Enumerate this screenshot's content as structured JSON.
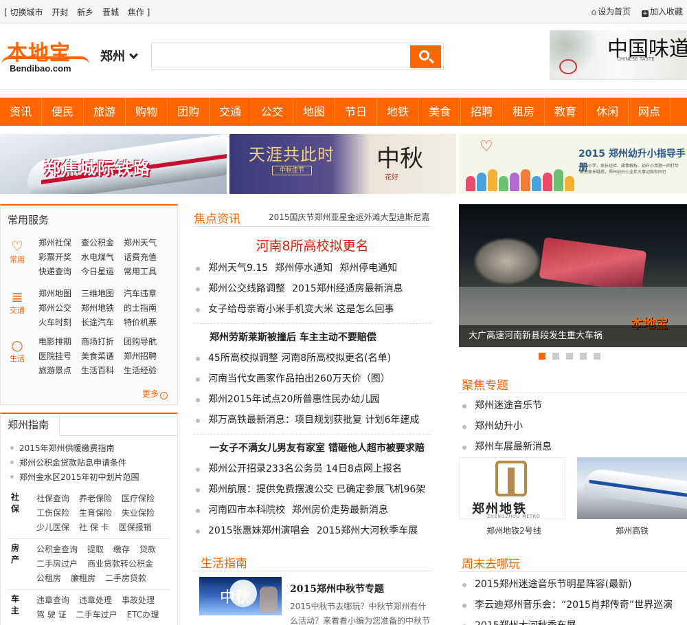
{
  "topbar": {
    "cities": [
      "[ 切换城市",
      "开封",
      "新乡",
      "晋城",
      "焦作 ]"
    ],
    "set_home": "设为首页",
    "add_fav": "加入收藏"
  },
  "header": {
    "logo_cn": "本地宝",
    "logo_en": "Bendibao.com",
    "city": "郑州",
    "search_placeholder": "",
    "banner_text": "中国味道",
    "banner_sub": "CHINESE TASTE"
  },
  "nav": [
    "资讯",
    "便民",
    "旅游",
    "购物",
    "团购",
    "交通",
    "公交",
    "地图",
    "节日",
    "地铁",
    "美食",
    "招聘",
    "租房",
    "教育",
    "休闲",
    "网点"
  ],
  "banners": {
    "b1": "郑焦城际铁路",
    "b2_title": "天涯共此时",
    "b2_tag": "中秋佳节",
    "b2_moon": "中秋",
    "b2_flower": "花好",
    "b3_title": "2015 郑州幼升小指导手册",
    "b3_sub": "重点小学、家长经验、政策解析、幼升小真题一网打尽 解答家长疑惑，郑州幼升小全年大事记陪你同行"
  },
  "services": {
    "title": "常用服务",
    "groups": [
      {
        "icon": "♡",
        "label": "常用",
        "links": [
          "郑州社保",
          "查公积金",
          "郑州天气",
          "彩票开奖",
          "水电煤气",
          "话费充值",
          "快递查询",
          "今日星运",
          "常用工具"
        ]
      },
      {
        "icon": "≣",
        "label": "交通",
        "links": [
          "郑州地图",
          "三维地图",
          "汽车违章",
          "郑州公交",
          "郑州地铁",
          "的士指南",
          "火车时刻",
          "长途汽车",
          "特价机票"
        ]
      },
      {
        "icon": "○",
        "label": "生活",
        "links": [
          "电影排期",
          "商场打折",
          "团购导航",
          "医院挂号",
          "美食菜谱",
          "郑州招聘",
          "旅游景点",
          "生活百科",
          "生活经验"
        ]
      }
    ],
    "more": "更多"
  },
  "guide": {
    "tab": "郑州指南",
    "bullets": [
      "2015年郑州供暖缴费指南",
      "郑州公积金贷款贴息申请条件",
      "郑州金水区2015年初中划片范围"
    ],
    "sections": [
      {
        "label": "社保",
        "links": [
          [
            "社保查询",
            "养老保险",
            "医疗保险"
          ],
          [
            "工伤保险",
            "生育保险",
            "失业保险"
          ],
          [
            "少儿医保",
            "社 保 卡",
            "医保报销"
          ]
        ]
      },
      {
        "label": "房产",
        "links": [
          [
            "公积金查询",
            "提取",
            "缴存",
            "贷款"
          ],
          [
            "二手房过户",
            "商业贷款转公积金"
          ],
          [
            "公租房",
            "廉租房",
            "二手房贷款"
          ]
        ]
      },
      {
        "label": "车主",
        "links": [
          [
            "违章查询",
            "违章处理",
            "事故处理"
          ],
          [
            "驾 驶 证",
            "二手车过户",
            "ETC办理"
          ]
        ]
      }
    ]
  },
  "focus": {
    "title": "焦点资讯",
    "ticker": "2015国庆节郑州亚星金运外滩大型迪斯尼嘉",
    "headline": "河南8所高校拟更名",
    "group1": [
      [
        "郑州天气9.15",
        "郑州停水通知",
        "郑州停电通知"
      ],
      [
        "郑州公交线路调整",
        "2015郑州经适房最新消息"
      ],
      [
        "女子给母亲寄小米手机变大米 这是怎么回事"
      ]
    ],
    "group2_head": "郑州劳斯莱斯被撞后 车主主动不要赔偿",
    "group2": [
      [
        "45所高校拟调整 河南8所高校拟更名(名单)"
      ],
      [
        "河南当代女画家作品拍出260万天价（图）"
      ],
      [
        "郑州2015年试点20所普惠性民办幼儿园"
      ],
      [
        "郑万高铁最新消息：项目规划获批复 计划6年建成"
      ]
    ],
    "group3_head": "一女子不满女儿男友有家室 错砸他人超市被要求赔",
    "group3": [
      [
        "郑州公开招录233名公务员 14日8点网上报名"
      ],
      [
        "郑州航展：提供免费摆渡公交 已确定参展飞机96架"
      ],
      [
        "河南四市本科院校",
        "郑州房价走势最新消息"
      ],
      [
        "2015张惠妹郑州演唱会",
        "2015郑州大河秋季车展"
      ]
    ]
  },
  "life": {
    "title": "生活指南",
    "img_word": "中秋",
    "item_title": "2015郑州中秋节专题",
    "item_desc": "2015中秋节去哪玩？中秋节郑州有什么活动？来看看小编为您准备的中秋节"
  },
  "slide": {
    "caption": "大广高速河南新县段发生重大车祸",
    "watermark": "本地宝",
    "dots": 5,
    "active": 0
  },
  "topics": {
    "title": "聚焦专题",
    "items": [
      "郑州迷途音乐节",
      "郑州幼升小",
      "郑州车展最新消息"
    ],
    "pics": [
      {
        "name": "郑州地铁",
        "en": "ZHENGZHOU METRO",
        "caption": "郑州地铁2号线"
      },
      {
        "caption": "郑州高铁"
      }
    ]
  },
  "weekend": {
    "title": "周末去哪玩",
    "items": [
      "2015郑州迷途音乐节明星阵容(最新)",
      "李云迪郑州音乐会：“2015肖邦传奇”世界巡演",
      "2015郑州大河秋季车展"
    ]
  },
  "colors": {
    "accent": "#ff6600",
    "headline": "#d81e06"
  }
}
